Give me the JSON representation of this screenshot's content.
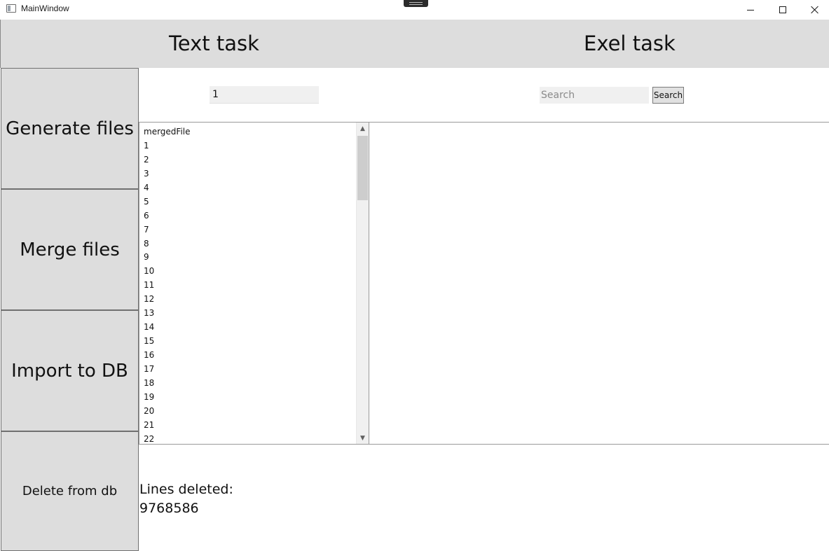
{
  "window": {
    "title": "MainWindow"
  },
  "header": {
    "text_task": "Text task",
    "exel_task": "Exel task"
  },
  "left_buttons": {
    "generate": "Generate files",
    "merge": "Merge files",
    "import": "Import to DB",
    "delete": "Delete from db"
  },
  "text_input": {
    "value": "1"
  },
  "search": {
    "placeholder": "Search",
    "button_label": "Search"
  },
  "file_list": {
    "items": [
      "mergedFile",
      "1",
      "2",
      "3",
      "4",
      "5",
      "6",
      "7",
      "8",
      "9",
      "10",
      "11",
      "12",
      "13",
      "14",
      "15",
      "16",
      "17",
      "18",
      "19",
      "20",
      "21",
      "22"
    ]
  },
  "status": {
    "label": "Lines deleted:",
    "value": "9768586"
  },
  "icons": {
    "app": "window-app-icon",
    "minimize": "minimize-icon",
    "maximize": "maximize-icon",
    "close": "close-icon",
    "scroll_up": "chevron-up-icon",
    "scroll_down": "chevron-down-icon"
  }
}
